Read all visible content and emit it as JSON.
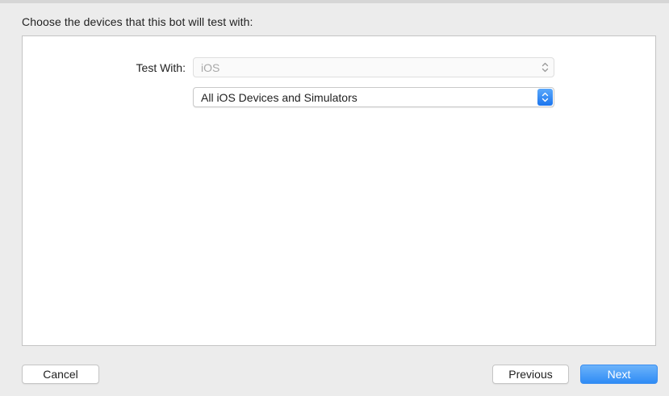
{
  "dialog": {
    "instruction": "Choose the devices that this bot will test with:"
  },
  "form": {
    "test_with_label": "Test With:",
    "platform_popup": {
      "value": "iOS",
      "enabled": false
    },
    "device_popup": {
      "value": "All iOS Devices and Simulators",
      "enabled": true
    }
  },
  "footer": {
    "cancel_label": "Cancel",
    "previous_label": "Previous",
    "next_label": "Next"
  },
  "colors": {
    "accent": "#2f8cf5",
    "sheet_background": "#ececec",
    "disabled_text": "#a8a8a8"
  },
  "icons": {
    "popup_stepper": "up-down-chevron-icon"
  }
}
